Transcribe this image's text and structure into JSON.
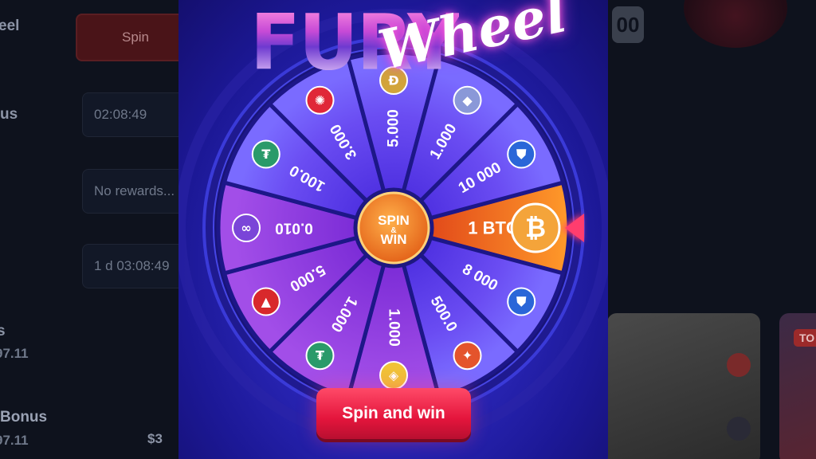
{
  "background": {
    "sidebar_labels": [
      "eel",
      "us",
      "s",
      "Bonus"
    ],
    "spin_label": "Spin",
    "timer_1": "02:08:49",
    "rewards_text": "No rewards...",
    "timer_2": "1 d 03:08:49",
    "amount_1": "97.11",
    "amount_2": "97.11",
    "amount_3": "$3",
    "balance_digits": "00",
    "card_tag": "TO"
  },
  "modal": {
    "title_fury": "FURY",
    "title_wheel": "Wheel",
    "hub_text_top": "SPIN",
    "hub_text_mid": "&",
    "hub_text_bottom": "WIN",
    "spin_button_label": "Spin and win"
  },
  "wheel": {
    "segments": [
      {
        "label": "1 BTC",
        "icon": "bitcoin-icon",
        "highlighted": true,
        "icon_color": "#f4a43a",
        "icon_glyph": "₿"
      },
      {
        "label": "8 000",
        "icon": "bfg-token-icon",
        "highlighted": false,
        "icon_color": "#2a66d8",
        "icon_glyph": "⛊"
      },
      {
        "label": "500.0",
        "icon": "shiba-icon",
        "highlighted": false,
        "icon_color": "#e4542c",
        "icon_glyph": "✦"
      },
      {
        "label": "1.000",
        "icon": "binance-icon",
        "highlighted": false,
        "icon_color": "#f0c238",
        "icon_glyph": "◈"
      },
      {
        "label": "1.000",
        "icon": "tether-icon",
        "highlighted": false,
        "icon_color": "#2a9a6a",
        "icon_glyph": "₮"
      },
      {
        "label": "5.000",
        "icon": "tron-icon",
        "highlighted": false,
        "icon_color": "#d8282c",
        "icon_glyph": "▲"
      },
      {
        "label": "0.010",
        "icon": "polygon-icon",
        "highlighted": false,
        "icon_color": "#7a45d8",
        "icon_glyph": "∞"
      },
      {
        "label": "100.0",
        "icon": "tether-icon",
        "highlighted": false,
        "icon_color": "#2a9a6a",
        "icon_glyph": "₮"
      },
      {
        "label": "3.000",
        "icon": "fury-token-icon",
        "highlighted": false,
        "icon_color": "#e02838",
        "icon_glyph": "✺"
      },
      {
        "label": "5.000",
        "icon": "dogecoin-icon",
        "highlighted": false,
        "icon_color": "#d2a43a",
        "icon_glyph": "Ð"
      },
      {
        "label": "1.000",
        "icon": "ethereum-icon",
        "highlighted": false,
        "icon_color": "#8a98d8",
        "icon_glyph": "◆"
      },
      {
        "label": "10 000",
        "icon": "bfg-token-icon",
        "highlighted": false,
        "icon_color": "#2a66d8",
        "icon_glyph": "⛊"
      }
    ]
  }
}
